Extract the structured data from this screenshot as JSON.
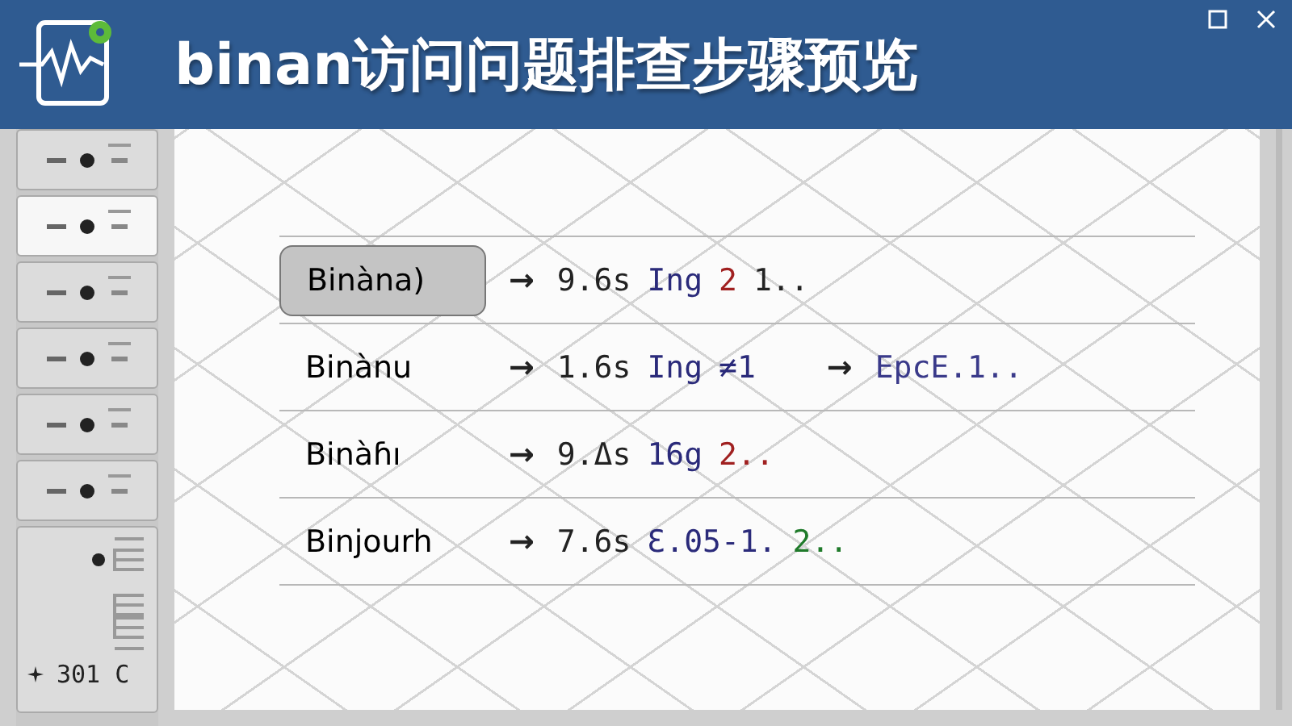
{
  "window": {
    "title": "binan访问问题排查步骤预览"
  },
  "sidebar": {
    "items": [
      {
        "selected": false
      },
      {
        "selected": true
      },
      {
        "selected": false
      },
      {
        "selected": false
      },
      {
        "selected": false
      },
      {
        "selected": false
      }
    ],
    "panel": {
      "label": "301 C"
    }
  },
  "rows": [
    {
      "name": "Binàna)",
      "selected": true,
      "parts": [
        {
          "kind": "arrow",
          "text": "→",
          "color": "#222222"
        },
        {
          "kind": "value",
          "text": "9.6s",
          "color": "#222222"
        },
        {
          "kind": "value",
          "text": "Ing",
          "color": "#2a2a7a"
        },
        {
          "kind": "value",
          "text": "2",
          "color": "#a02020"
        },
        {
          "kind": "value",
          "text": "1..",
          "color": "#222222"
        }
      ]
    },
    {
      "name": "Binànu",
      "selected": false,
      "parts": [
        {
          "kind": "arrow",
          "text": "→",
          "color": "#222222"
        },
        {
          "kind": "value",
          "text": "1.6s",
          "color": "#222222"
        },
        {
          "kind": "value",
          "text": "Ing",
          "color": "#2a2a7a"
        },
        {
          "kind": "value",
          "text": "≠1",
          "color": "#2a2a7a"
        },
        {
          "kind": "arrow",
          "text": "→",
          "color": "#222222"
        },
        {
          "kind": "value",
          "text": "EpcE.1..",
          "color": "#3a3a8a"
        }
      ]
    },
    {
      "name": "Binàɦı",
      "selected": false,
      "parts": [
        {
          "kind": "arrow",
          "text": "→",
          "color": "#222222"
        },
        {
          "kind": "value",
          "text": "9.Δs",
          "color": "#222222"
        },
        {
          "kind": "value",
          "text": "16g",
          "color": "#2a2a7a"
        },
        {
          "kind": "value",
          "text": "2..",
          "color": "#a02020"
        }
      ]
    },
    {
      "name": "Binjourh",
      "selected": false,
      "parts": [
        {
          "kind": "arrow",
          "text": "→",
          "color": "#222222"
        },
        {
          "kind": "value",
          "text": "7.6s",
          "color": "#222222"
        },
        {
          "kind": "value",
          "text": "Ɛ.05-1.",
          "color": "#2a2a7a"
        },
        {
          "kind": "value",
          "text": "2..",
          "color": "#1f7a2a"
        }
      ]
    }
  ]
}
